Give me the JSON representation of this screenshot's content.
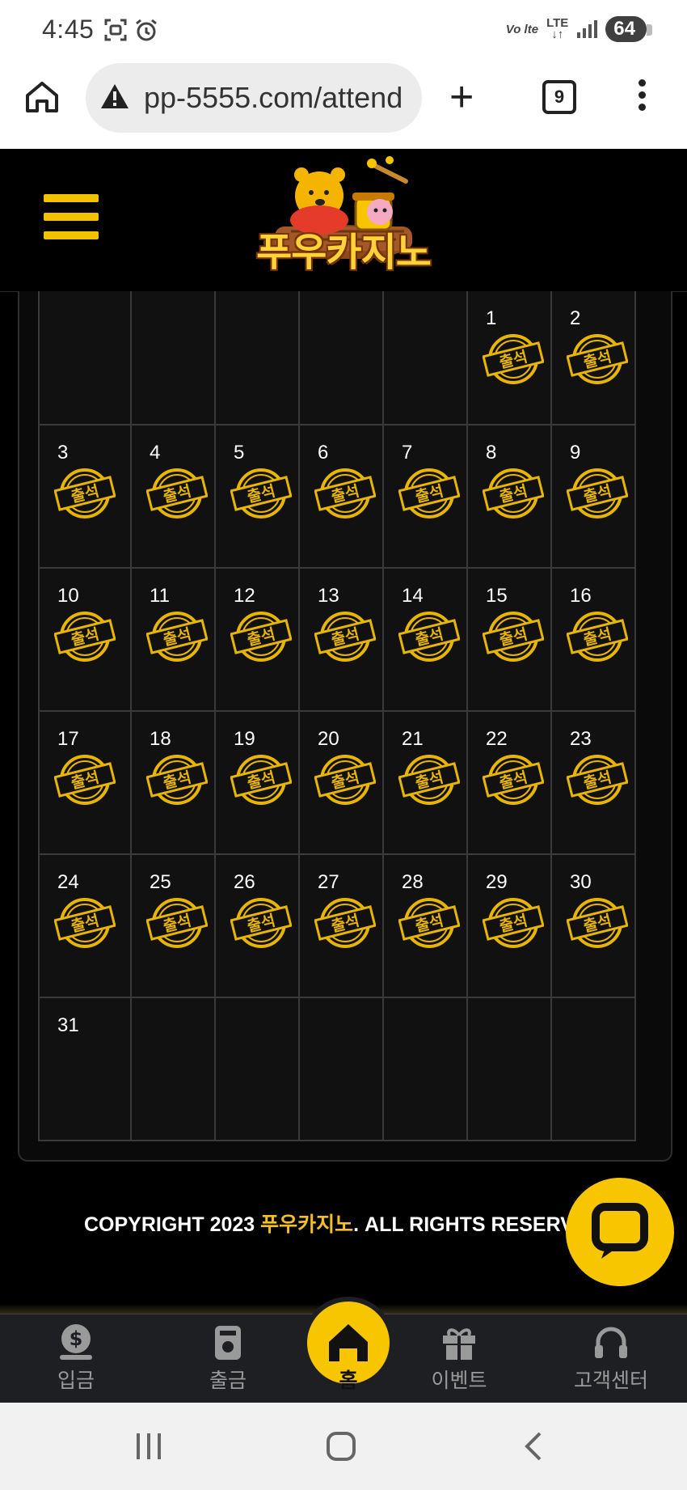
{
  "status_bar": {
    "time": "4:45",
    "volte": "Vo lte",
    "lte": "LTE",
    "battery": "64"
  },
  "browser": {
    "url": "pp-5555.com/attend",
    "tab_count": "9"
  },
  "site": {
    "logo_text": "푸우카지노"
  },
  "calendar": {
    "stamp_label": "출석",
    "stamp_color": "#e8b500",
    "weeks": [
      [
        "",
        "",
        "",
        "",
        "",
        "1",
        "2"
      ],
      [
        "3",
        "4",
        "5",
        "6",
        "7",
        "8",
        "9"
      ],
      [
        "10",
        "11",
        "12",
        "13",
        "14",
        "15",
        "16"
      ],
      [
        "17",
        "18",
        "19",
        "20",
        "21",
        "22",
        "23"
      ],
      [
        "24",
        "25",
        "26",
        "27",
        "28",
        "29",
        "30"
      ],
      [
        "31",
        "",
        "",
        "",
        "",
        "",
        ""
      ]
    ],
    "attended_days": [
      "1",
      "2",
      "3",
      "4",
      "5",
      "6",
      "7",
      "8",
      "9",
      "10",
      "11",
      "12",
      "13",
      "14",
      "15",
      "16",
      "17",
      "18",
      "19",
      "20",
      "21",
      "22",
      "23",
      "24",
      "25",
      "26",
      "27",
      "28",
      "29",
      "30"
    ]
  },
  "footer": {
    "copyright_prefix": "COPYRIGHT 2023 ",
    "copyright_brand": "푸우카지노",
    "copyright_suffix": ". ALL RIGHTS RESERV"
  },
  "bottom_nav": {
    "items": [
      {
        "label": "입금",
        "icon": "deposit-icon"
      },
      {
        "label": "출금",
        "icon": "withdraw-icon"
      },
      {
        "label": "홈",
        "icon": "home-icon"
      },
      {
        "label": "이벤트",
        "icon": "gift-icon"
      },
      {
        "label": "고객센터",
        "icon": "headset-icon"
      }
    ]
  },
  "colors": {
    "accent": "#f7c600",
    "brand_text": "#f3bf2a"
  }
}
